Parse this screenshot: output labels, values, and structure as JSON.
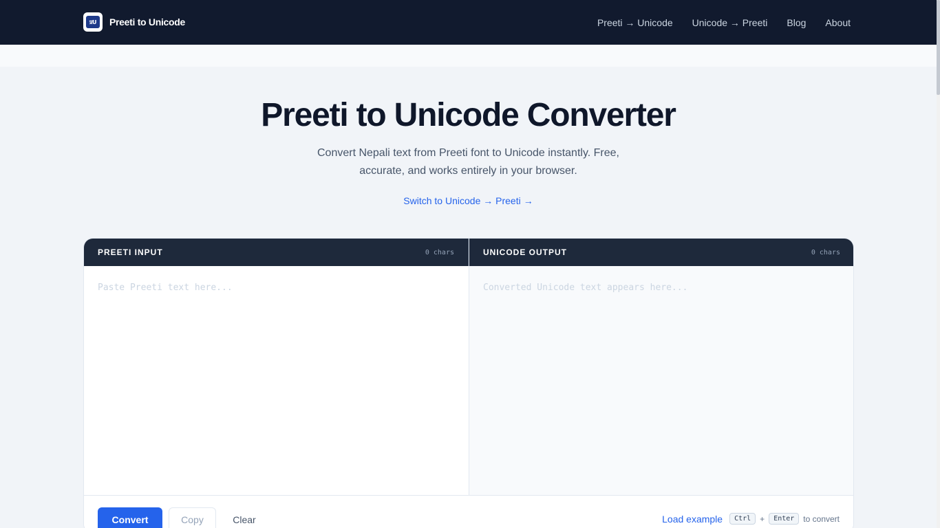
{
  "nav": {
    "brand_logo_text": "प्रU",
    "brand_name": "Preeti to Unicode",
    "links": [
      {
        "label": "Preeti → Unicode"
      },
      {
        "label": "Unicode → Preeti"
      },
      {
        "label": "Blog"
      },
      {
        "label": "About"
      }
    ]
  },
  "hero": {
    "title": "Preeti to Unicode Converter",
    "subtitle": "Convert Nepali text from Preeti font to Unicode instantly. Free, accurate, and works entirely in your browser.",
    "switch_label": "Switch to Unicode → Preeti",
    "switch_arrow": "→"
  },
  "converter": {
    "input": {
      "title": "PREETI INPUT",
      "count": "0 chars",
      "placeholder": "Paste Preeti text here..."
    },
    "output": {
      "title": "UNICODE OUTPUT",
      "count": "0 chars",
      "placeholder": "Converted Unicode text appears here..."
    },
    "actions": {
      "convert": "Convert",
      "copy": "Copy",
      "clear": "Clear",
      "load_example": "Load example",
      "shortcut_key1": "Ctrl",
      "shortcut_plus": "+",
      "shortcut_key2": "Enter",
      "shortcut_suffix": "to convert"
    }
  },
  "colors": {
    "nav_bg": "#111a2e",
    "accent": "#2563eb",
    "pane_header": "#1e293b"
  }
}
